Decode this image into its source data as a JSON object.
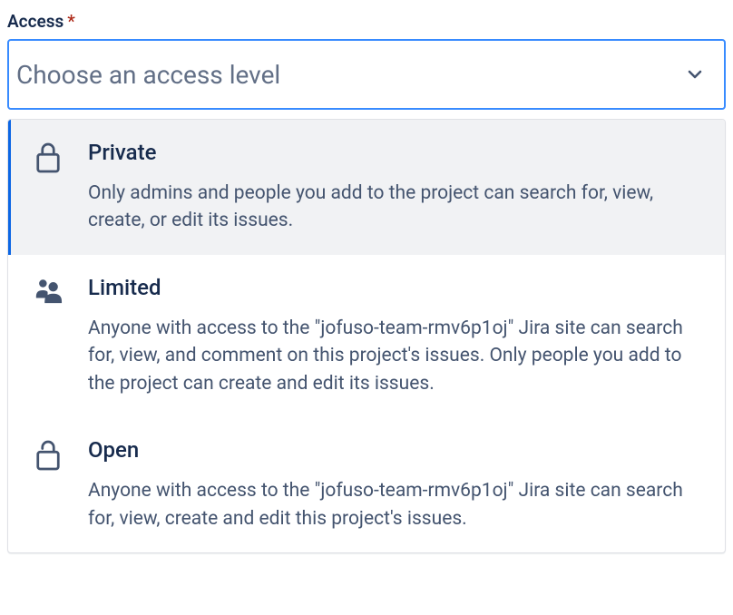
{
  "field": {
    "label": "Access",
    "required_marker": "*",
    "placeholder": "Choose an access level"
  },
  "options": [
    {
      "title": "Private",
      "description": "Only admins and people you add to the project can search for, view, create, or edit its issues."
    },
    {
      "title": "Limited",
      "description": "Anyone with access to the \"jofuso-team-rmv6p1oj\" Jira site can search for, view, and comment on this project's issues. Only people you add to the project can create and edit its issues."
    },
    {
      "title": "Open",
      "description": "Anyone with access to the \"jofuso-team-rmv6p1oj\" Jira site can search for, view, create and edit this project's issues."
    }
  ]
}
